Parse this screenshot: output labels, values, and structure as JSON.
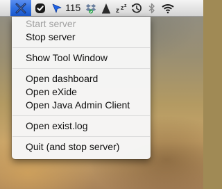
{
  "menubar": {
    "exist_icon": "exist-db-icon",
    "checkmark_icon": "checkmark-shield-icon",
    "cursor_icon": "cursor-arrow-icon",
    "cursor_count": "115",
    "dropbox_icon": "dropbox-icon",
    "alert_icon": "alert-icon",
    "sleep_icon": "sleep-zzz-icon",
    "time_machine_icon": "time-machine-icon",
    "bluetooth_icon": "bluetooth-icon",
    "wifi_icon": "wifi-icon",
    "accent_color": "#2f6fe0"
  },
  "menu": {
    "group1": {
      "start_server": "Start server",
      "stop_server": "Stop server"
    },
    "group2": {
      "show_tool_window": "Show Tool Window"
    },
    "group3": {
      "open_dashboard": "Open dashboard",
      "open_exide": "Open eXide",
      "open_java_admin": "Open Java Admin Client"
    },
    "group4": {
      "open_log": "Open exist.log"
    },
    "group5": {
      "quit": "Quit (and stop server)"
    }
  }
}
